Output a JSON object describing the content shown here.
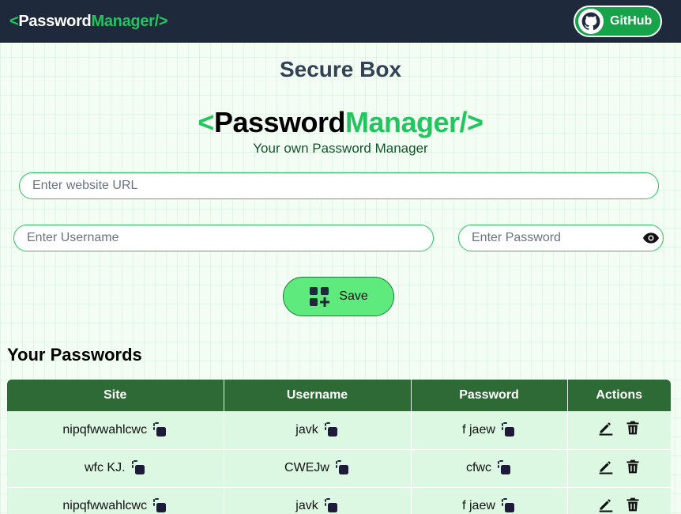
{
  "navbar": {
    "logo_open": "<",
    "logo_main": "Password",
    "logo_accent": "Manager/>",
    "github_label": "GitHub",
    "github_icon": "github-icon"
  },
  "header": {
    "title": "Secure Box",
    "brand_open": "<",
    "brand_main": "Password",
    "brand_accent": "Manager/>",
    "tagline": "Your own Password Manager"
  },
  "form": {
    "url_placeholder": "Enter website URL",
    "username_placeholder": "Enter Username",
    "password_placeholder": "Enter Password",
    "url_value": "",
    "username_value": "",
    "password_value": "",
    "show_password_icon": "eye-icon",
    "save_label": "Save",
    "save_icon": "add-grid-icon"
  },
  "passwords": {
    "heading": "Your Passwords",
    "columns": [
      "Site",
      "Username",
      "Password",
      "Actions"
    ],
    "rows": [
      {
        "site": "nipqfwwahlcwc",
        "username": "javk",
        "password": "f jaew"
      },
      {
        "site": "wfc KJ.",
        "username": "CWEJw",
        "password": "cfwc"
      },
      {
        "site": "nipqfwwahlcwc",
        "username": "javk",
        "password": "f jaew"
      }
    ],
    "copy_icon": "copy-icon",
    "edit_icon": "edit-icon",
    "delete_icon": "trash-icon"
  },
  "colors": {
    "navbar_bg": "#1e293b",
    "accent_green": "#22c55e",
    "table_header": "#2d6a35",
    "table_row": "#dcf7e2",
    "save_button": "#5eea7c"
  }
}
